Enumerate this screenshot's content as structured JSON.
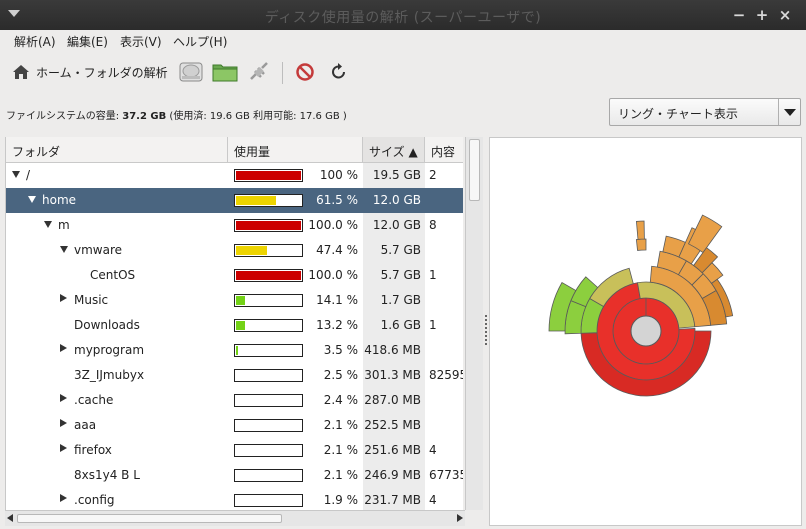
{
  "window": {
    "title": "ディスク使用量の解析 (スーパーユーザで)",
    "minimize": "−",
    "maximize": "+",
    "close": "×"
  },
  "menubar": {
    "items": [
      {
        "label": "解析(A)"
      },
      {
        "label": "編集(E)"
      },
      {
        "label": "表示(V)"
      },
      {
        "label": "ヘルプ(H)"
      }
    ]
  },
  "toolbar": {
    "home_label": "ホーム・フォルダの解析",
    "icons": [
      "home-icon",
      "hard-drive-icon",
      "folder-icon",
      "remote-folder-icon",
      "stop-icon",
      "refresh-icon"
    ]
  },
  "fsinfo": {
    "prefix": "ファイルシステムの容量: ",
    "capacity": "37.2 GB",
    "detail": " (使用済: 19.6 GB 利用可能: 17.6 GB )"
  },
  "view_select": {
    "selected": "リング・チャート表示"
  },
  "tree": {
    "columns": [
      {
        "label": "フォルダ"
      },
      {
        "label": "使用量"
      },
      {
        "label": "サイズ ▲"
      },
      {
        "label": "内容"
      }
    ],
    "rows": [
      {
        "name": "/",
        "depth": 0,
        "expander": "open",
        "fraction": 1.0,
        "color": "#cc0000",
        "percent": "100 %",
        "size": "19.5 GB",
        "contents": "2",
        "selected": false
      },
      {
        "name": "home",
        "depth": 1,
        "expander": "open",
        "fraction": 0.615,
        "color": "#edd400",
        "percent": "61.5 %",
        "size": "12.0 GB",
        "contents": "",
        "selected": true
      },
      {
        "name": "m",
        "depth": 2,
        "expander": "open",
        "fraction": 1.0,
        "color": "#cc0000",
        "percent": "100.0 %",
        "size": "12.0 GB",
        "contents": "8",
        "selected": false
      },
      {
        "name": "vmware",
        "depth": 3,
        "expander": "open",
        "fraction": 0.474,
        "color": "#edd400",
        "percent": "47.4 %",
        "size": "5.7 GB",
        "contents": "",
        "selected": false
      },
      {
        "name": "CentOS",
        "depth": 4,
        "expander": "none",
        "fraction": 1.0,
        "color": "#cc0000",
        "percent": "100.0 %",
        "size": "5.7 GB",
        "contents": "1",
        "selected": false
      },
      {
        "name": "Music",
        "depth": 3,
        "expander": "closed",
        "fraction": 0.141,
        "color": "#73d216",
        "percent": "14.1 %",
        "size": "1.7 GB",
        "contents": "",
        "selected": false
      },
      {
        "name": "Downloads",
        "depth": 3,
        "expander": "none",
        "fraction": 0.132,
        "color": "#73d216",
        "percent": "13.2 %",
        "size": "1.6 GB",
        "contents": "1",
        "selected": false
      },
      {
        "name": "myprogram",
        "depth": 3,
        "expander": "closed",
        "fraction": 0.035,
        "color": "#73d216",
        "percent": "3.5 %",
        "size": "418.6 MB",
        "contents": "",
        "selected": false
      },
      {
        "name": "3Z_IJmubyx",
        "depth": 3,
        "expander": "none",
        "fraction": 0.025,
        "color": "#ffffff",
        "percent": "2.5 %",
        "size": "301.3 MB",
        "contents": "82595",
        "selected": false
      },
      {
        "name": ".cache",
        "depth": 3,
        "expander": "closed",
        "fraction": 0.024,
        "color": "#ffffff",
        "percent": "2.4 %",
        "size": "287.0 MB",
        "contents": "",
        "selected": false
      },
      {
        "name": "aaa",
        "depth": 3,
        "expander": "closed",
        "fraction": 0.021,
        "color": "#ffffff",
        "percent": "2.1 %",
        "size": "252.5 MB",
        "contents": "",
        "selected": false
      },
      {
        "name": "firefox",
        "depth": 3,
        "expander": "closed",
        "fraction": 0.021,
        "color": "#ffffff",
        "percent": "2.1 %",
        "size": "251.6 MB",
        "contents": "4",
        "selected": false
      },
      {
        "name": "8xs1y4 B L",
        "depth": 3,
        "expander": "none",
        "fraction": 0.021,
        "color": "#ffffff",
        "percent": "2.1 %",
        "size": "246.9 MB",
        "contents": "67735",
        "selected": false
      },
      {
        "name": ".config",
        "depth": 3,
        "expander": "closed",
        "fraction": 0.019,
        "color": "#ffffff",
        "percent": "1.9 %",
        "size": "231.7 MB",
        "contents": "4",
        "selected": false
      }
    ]
  },
  "ring_chart": {
    "colors": {
      "red": "#e8302a",
      "red_dark": "#d82a24",
      "green": "#8ccf3e",
      "olive": "#c8c05a",
      "orange": "#e8a048",
      "orange_dark": "#d88a30",
      "center": "#d4d4d4"
    }
  }
}
